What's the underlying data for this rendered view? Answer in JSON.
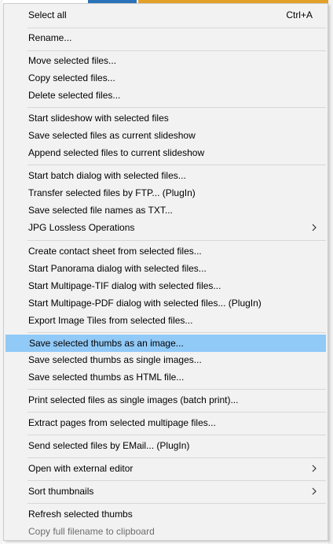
{
  "menu": {
    "select_all": "Select all",
    "select_all_shortcut": "Ctrl+A",
    "rename": "Rename...",
    "move": "Move selected files...",
    "copy": "Copy selected files...",
    "delete": "Delete selected files...",
    "slideshow_start": "Start slideshow with selected files",
    "slideshow_save": "Save selected files as current slideshow",
    "slideshow_append": "Append selected files to current slideshow",
    "batch": "Start batch dialog with selected files...",
    "ftp": "Transfer selected files by FTP... (PlugIn)",
    "save_names_txt": "Save selected file names as TXT...",
    "jpg_lossless": "JPG Lossless Operations",
    "contact_sheet": "Create contact sheet from selected files...",
    "panorama": "Start Panorama dialog with selected files...",
    "multipage_tif": "Start Multipage-TIF dialog with selected files...",
    "multipage_pdf": "Start Multipage-PDF dialog with selected files... (PlugIn)",
    "export_tiles": "Export Image Tiles from selected files...",
    "thumbs_image": "Save selected thumbs as an image...",
    "thumbs_single": "Save selected thumbs as single images...",
    "thumbs_html": "Save selected thumbs as HTML file...",
    "print_batch": "Print selected files as single images (batch print)...",
    "extract_pages": "Extract pages from selected multipage files...",
    "email": "Send selected files by EMail... (PlugIn)",
    "external_editor": "Open with external editor",
    "sort_thumbs": "Sort thumbnails",
    "refresh": "Refresh selected thumbs",
    "copy_filename": "Copy full filename to clipboard"
  },
  "colors": {
    "menu_bg": "#f2f2f2",
    "hover_bg": "#91c9f7",
    "separator": "#d7d7d7",
    "disabled_text": "#6d6d6d"
  },
  "icons": {
    "submenu": "chevron-right-icon"
  }
}
